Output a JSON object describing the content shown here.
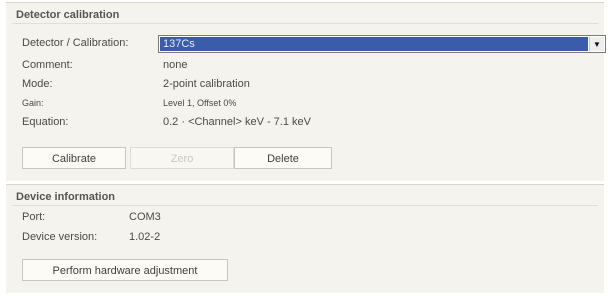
{
  "calibration": {
    "section_title": "Detector calibration",
    "detector_label": "Detector / Calibration:",
    "detector_value": "137Cs",
    "comment_label": "Comment:",
    "comment_value": "none",
    "mode_label": "Mode:",
    "mode_value": "2-point calibration",
    "gain_label": "Gain:",
    "gain_value": "Level 1, Offset 0%",
    "equation_label": "Equation:",
    "equation_value": "0.2 · <Channel> keV - 7.1 keV",
    "buttons": {
      "calibrate": "Calibrate",
      "zero": "Zero",
      "delete": "Delete"
    }
  },
  "device": {
    "section_title": "Device information",
    "port_label": "Port:",
    "port_value": "COM3",
    "version_label": "Device version:",
    "version_value": "1.02-2",
    "hardware_button": "Perform hardware adjustment"
  },
  "icons": {
    "dropdown": "chevron-down-icon"
  },
  "colors": {
    "selection": "#3b5bab",
    "panel_bg": "#f4f3ee"
  }
}
